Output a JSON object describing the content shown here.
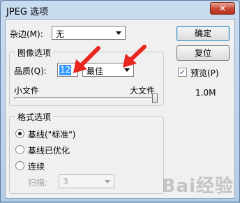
{
  "window": {
    "title": "JPEG 选项",
    "close_glyph": "✕"
  },
  "matte": {
    "label": "杂边(M):",
    "value": "无"
  },
  "buttons": {
    "ok": "确定",
    "reset": "复位"
  },
  "preview": {
    "checked": true,
    "check_glyph": "✓",
    "label": "预览(P)",
    "size": "1.0M"
  },
  "image_options": {
    "group_title": "图像选项",
    "quality_label": "品质(Q):",
    "quality_value": "12",
    "quality_preset": "最佳",
    "small_file_label": "小文件",
    "large_file_label": "大文件",
    "quality_level": 1.0
  },
  "format_options": {
    "group_title": "格式选项",
    "radios": [
      {
        "label": "基线(\"标准\")",
        "checked": true
      },
      {
        "label": "基线已优化",
        "checked": false
      },
      {
        "label": "连续",
        "checked": false
      }
    ],
    "scans_label": "扫描:",
    "scans_value": "3"
  },
  "colors": {
    "arrow": "#e8261f",
    "accent_selection": "#3399ff"
  },
  "watermark": "Bai经验"
}
